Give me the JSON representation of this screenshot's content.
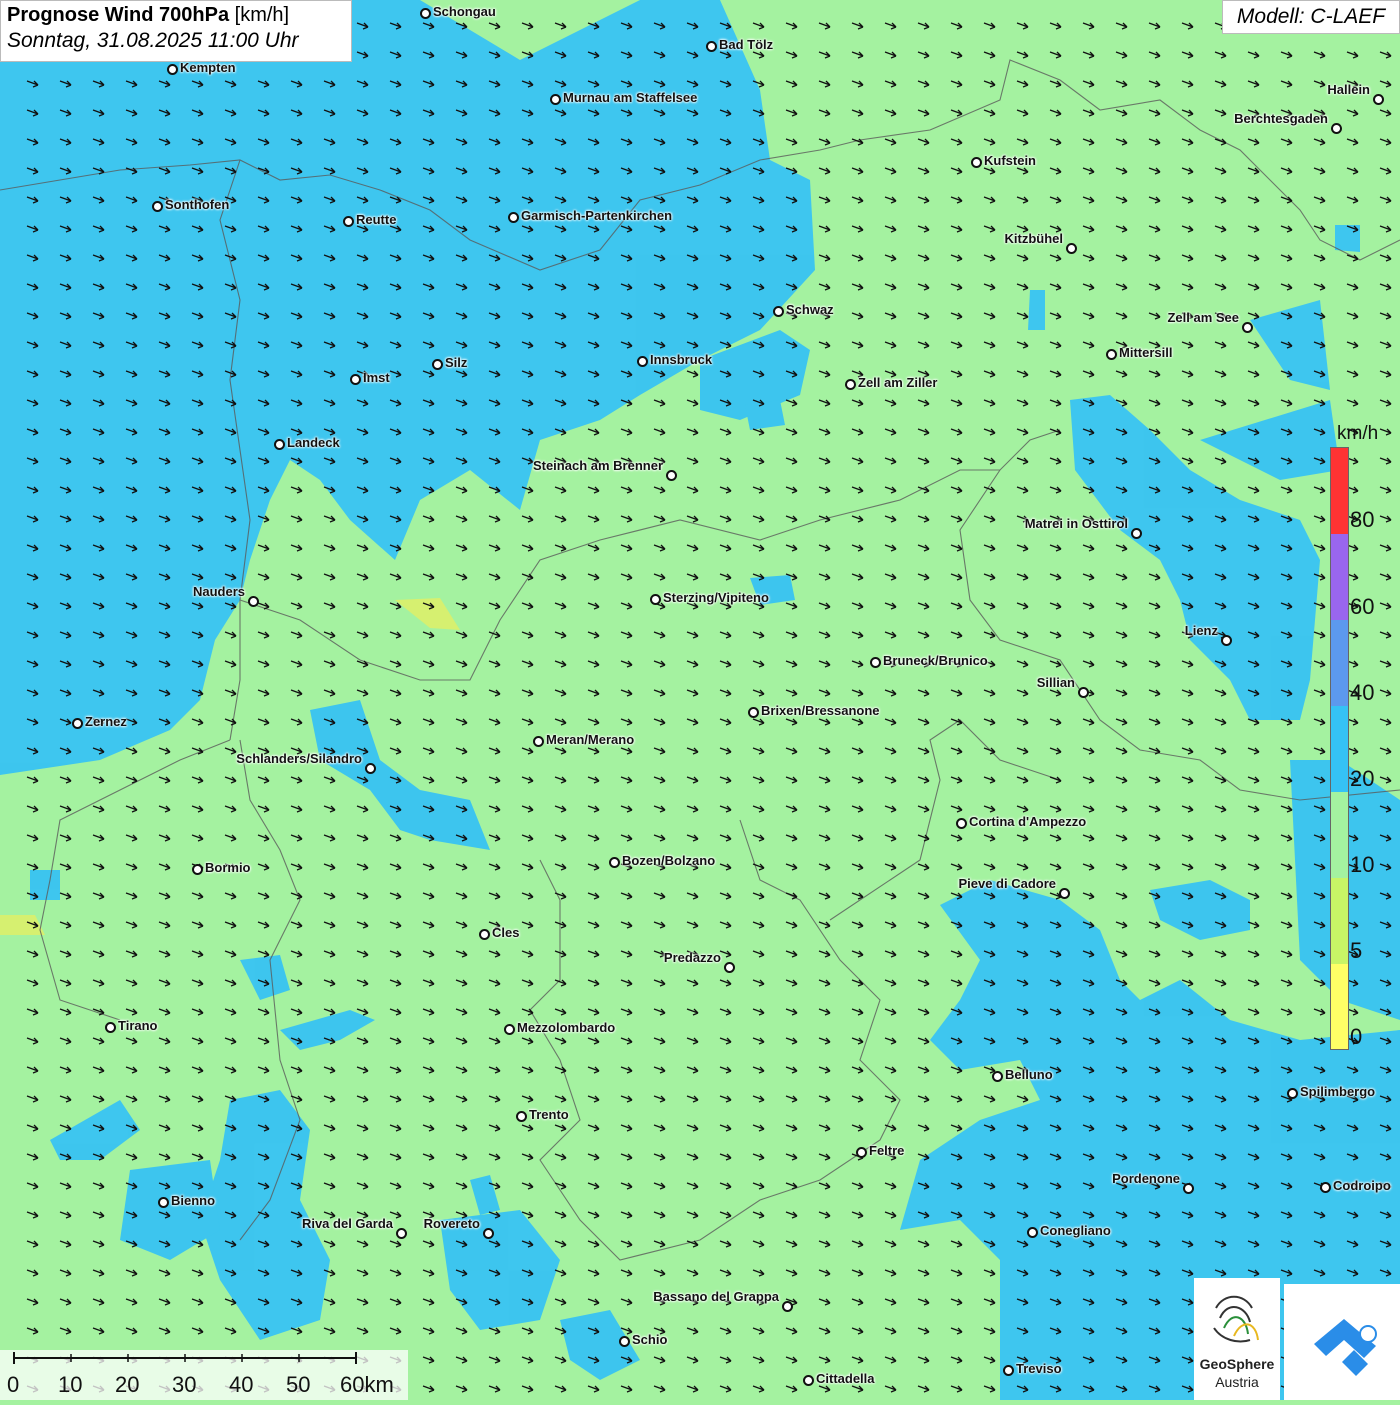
{
  "title": {
    "main": "Prognose Wind 700hPa",
    "unit": "[km/h]",
    "datetime": "Sonntag, 31.08.2025 11:00 Uhr"
  },
  "model": "Modell: C-LAEF",
  "legend": {
    "unit": "km/h",
    "labels": [
      "80",
      "60",
      "40",
      "20",
      "10",
      "5",
      "0"
    ],
    "colors": {
      "0-5": "#ffff66",
      "5-10": "#c8f566",
      "10-20": "#a4f2a0",
      "20-40": "#35c2f5",
      "40-60": "#5c99ee",
      "60-80": "#9966ee",
      "80+": "#ff3333"
    }
  },
  "scalebar": {
    "labels": [
      "0",
      "10",
      "20",
      "30",
      "40",
      "50",
      "60km"
    ]
  },
  "cities": [
    {
      "name": "Schongau"
    },
    {
      "name": "Bad Tölz"
    },
    {
      "name": "Kempten"
    },
    {
      "name": "Murnau am Staffelsee"
    },
    {
      "name": "Hallein"
    },
    {
      "name": "Berchtesgaden"
    },
    {
      "name": "Kufstein"
    },
    {
      "name": "Sonthofen"
    },
    {
      "name": "Reutte"
    },
    {
      "name": "Garmisch-Partenkirchen"
    },
    {
      "name": "Kitzbühel"
    },
    {
      "name": "Schwaz"
    },
    {
      "name": "Zell am See"
    },
    {
      "name": "Mittersill"
    },
    {
      "name": "Innsbruck"
    },
    {
      "name": "Silz"
    },
    {
      "name": "Imst"
    },
    {
      "name": "Zell am Ziller"
    },
    {
      "name": "Landeck"
    },
    {
      "name": "Steinach am Brenner"
    },
    {
      "name": "Matrei in Osttirol"
    },
    {
      "name": "Nauders"
    },
    {
      "name": "Sterzing/Vipiteno"
    },
    {
      "name": "Lienz"
    },
    {
      "name": "Bruneck/Brunico"
    },
    {
      "name": "Sillian"
    },
    {
      "name": "Zernez"
    },
    {
      "name": "Brixen/Bressanone"
    },
    {
      "name": "Meran/Merano"
    },
    {
      "name": "Schlanders/Silandro"
    },
    {
      "name": "Cortina d'Ampezzo"
    },
    {
      "name": "Bozen/Bolzano"
    },
    {
      "name": "Bormio"
    },
    {
      "name": "Pieve di Cadore"
    },
    {
      "name": "Cles"
    },
    {
      "name": "Predazzo"
    },
    {
      "name": "Tirano"
    },
    {
      "name": "Mezzolombardo"
    },
    {
      "name": "Belluno"
    },
    {
      "name": "Spilimbergo"
    },
    {
      "name": "Trento"
    },
    {
      "name": "Feltre"
    },
    {
      "name": "Pordenone"
    },
    {
      "name": "Codroipo"
    },
    {
      "name": "Bienno"
    },
    {
      "name": "Riva del Garda"
    },
    {
      "name": "Rovereto"
    },
    {
      "name": "Conegliano"
    },
    {
      "name": "Bassano del Grappa"
    },
    {
      "name": "Schio"
    },
    {
      "name": "Treviso"
    },
    {
      "name": "Cittadella"
    }
  ],
  "logos": {
    "geosphere": [
      "GeoSphere",
      "Austria"
    ]
  },
  "wind": {
    "direction_deg_from": 300,
    "typical_speed_kmh": 15
  }
}
